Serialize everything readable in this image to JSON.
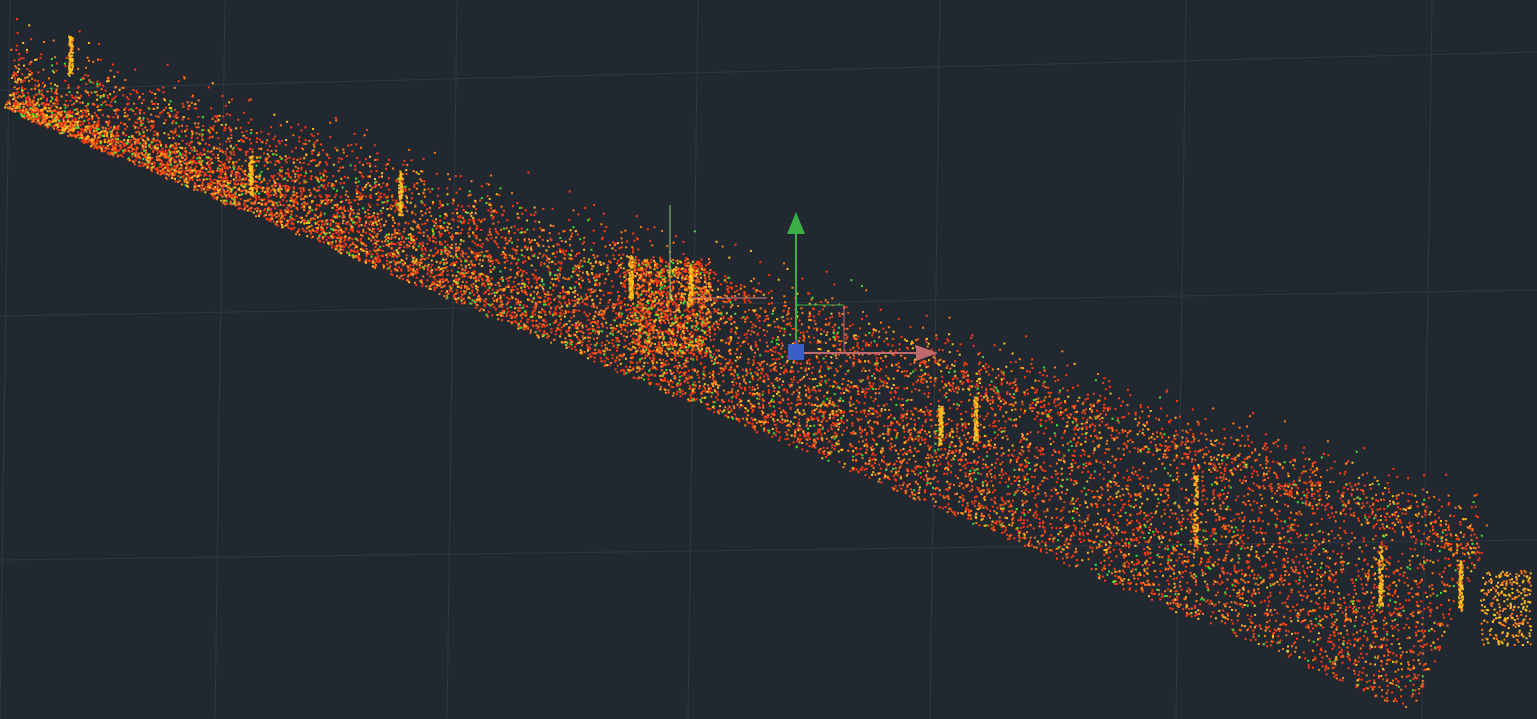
{
  "viewport": {
    "background_color": "#212830",
    "grid_color": "#2f3842",
    "point_cloud_colors": {
      "dominant": "#ff3b12",
      "secondary": "#ff7a18",
      "highlight": "#ffc21e",
      "accent": "#3be238"
    }
  },
  "ucs_gizmo": {
    "x_axis_color": "#c06a70",
    "y_axis_color": "#3cb048",
    "z_axis_color": "#3b5fc9",
    "icons": [
      "x-axis-arrow-icon",
      "y-axis-arrow-icon",
      "origin-cube-icon"
    ]
  }
}
